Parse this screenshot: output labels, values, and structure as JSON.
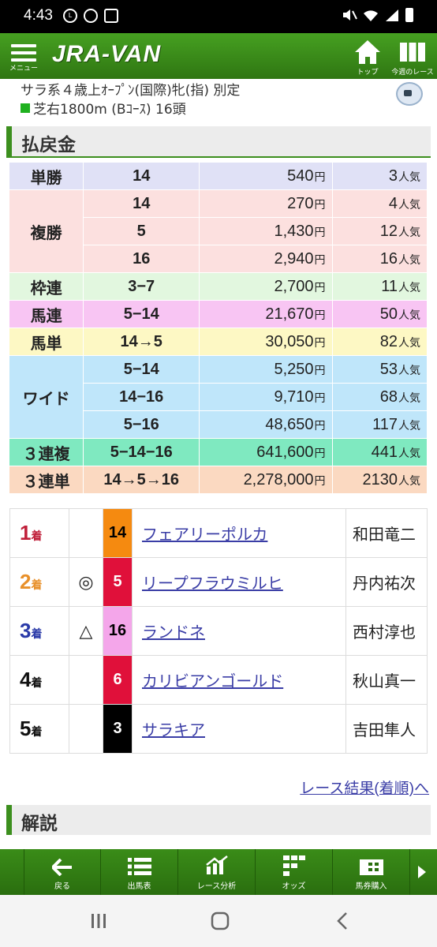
{
  "status": {
    "time": "4:43"
  },
  "header": {
    "menu_label": "メニュー",
    "logo": "JRA-VAN",
    "top_label": "トップ",
    "week_label": "今週のレース"
  },
  "race": {
    "line1": "サラ系４歳上ｵｰﾌﾟﾝ(国際)牝(指) 別定",
    "line2": "芝右1800m (Bｺｰｽ) 16頭"
  },
  "payout": {
    "title": "払戻金",
    "unit_yen": "円",
    "unit_pop": "人気",
    "rows": [
      {
        "type": "単勝",
        "nums": "14",
        "amount": "540",
        "pop": "3",
        "bg": "#e0e1f6"
      },
      {
        "type": "複勝",
        "nums": "14",
        "amount": "270",
        "pop": "4",
        "bg": "#fce0df"
      },
      {
        "type": "",
        "nums": "5",
        "amount": "1,430",
        "pop": "12",
        "bg": "#fce0df"
      },
      {
        "type": "",
        "nums": "16",
        "amount": "2,940",
        "pop": "16",
        "bg": "#fce0df"
      },
      {
        "type": "枠連",
        "nums": "3−7",
        "amount": "2,700",
        "pop": "11",
        "bg": "#e2f7df"
      },
      {
        "type": "馬連",
        "nums": "5−14",
        "amount": "21,670",
        "pop": "50",
        "bg": "#f8c5f3"
      },
      {
        "type": "馬単",
        "nums": "14→5",
        "amount": "30,050",
        "pop": "82",
        "bg": "#fdf8c4"
      },
      {
        "type": "ワイド",
        "nums": "5−14",
        "amount": "5,250",
        "pop": "53",
        "bg": "#bfe6fa"
      },
      {
        "type": "",
        "nums": "14−16",
        "amount": "9,710",
        "pop": "68",
        "bg": "#bfe6fa"
      },
      {
        "type": "",
        "nums": "5−16",
        "amount": "48,650",
        "pop": "117",
        "bg": "#bfe6fa"
      },
      {
        "type": "３連複",
        "nums": "5−14−16",
        "amount": "641,600",
        "pop": "441",
        "bg": "#7fe9c0"
      },
      {
        "type": "３連単",
        "nums": "14→5→16",
        "amount": "2,278,000",
        "pop": "2130",
        "bg": "#fbd9c1"
      }
    ]
  },
  "results": {
    "rank_unit": "着",
    "rows": [
      {
        "rank": "1",
        "rank_color": "#c0203a",
        "mark": "",
        "num": "14",
        "num_bg": "#f58a10",
        "num_fg": "#000000",
        "horse": "フェアリーポルカ",
        "jockey": "和田竜二"
      },
      {
        "rank": "2",
        "rank_color": "#e8902a",
        "mark": "◎",
        "num": "5",
        "num_bg": "#e0103a",
        "num_fg": "#ffffff",
        "horse": "リープフラウミルヒ",
        "jockey": "丹内祐次"
      },
      {
        "rank": "3",
        "rank_color": "#2a3aa8",
        "mark": "△",
        "num": "16",
        "num_bg": "#f4a6ea",
        "num_fg": "#000000",
        "horse": "ランドネ",
        "jockey": "西村淳也"
      },
      {
        "rank": "4",
        "rank_color": "#111111",
        "mark": "",
        "num": "6",
        "num_bg": "#e0103a",
        "num_fg": "#ffffff",
        "horse": "カリビアンゴールド",
        "jockey": "秋山真一"
      },
      {
        "rank": "5",
        "rank_color": "#111111",
        "mark": "",
        "num": "3",
        "num_bg": "#000000",
        "num_fg": "#ffffff",
        "horse": "サラキア",
        "jockey": "吉田隼人"
      }
    ]
  },
  "more_link": "レース結果(着順)へ",
  "comment_title": "解説",
  "bottomnav": {
    "back": "戻る",
    "entries": "出馬表",
    "analysis": "レース分析",
    "odds": "オッズ",
    "buy": "馬券購入"
  }
}
